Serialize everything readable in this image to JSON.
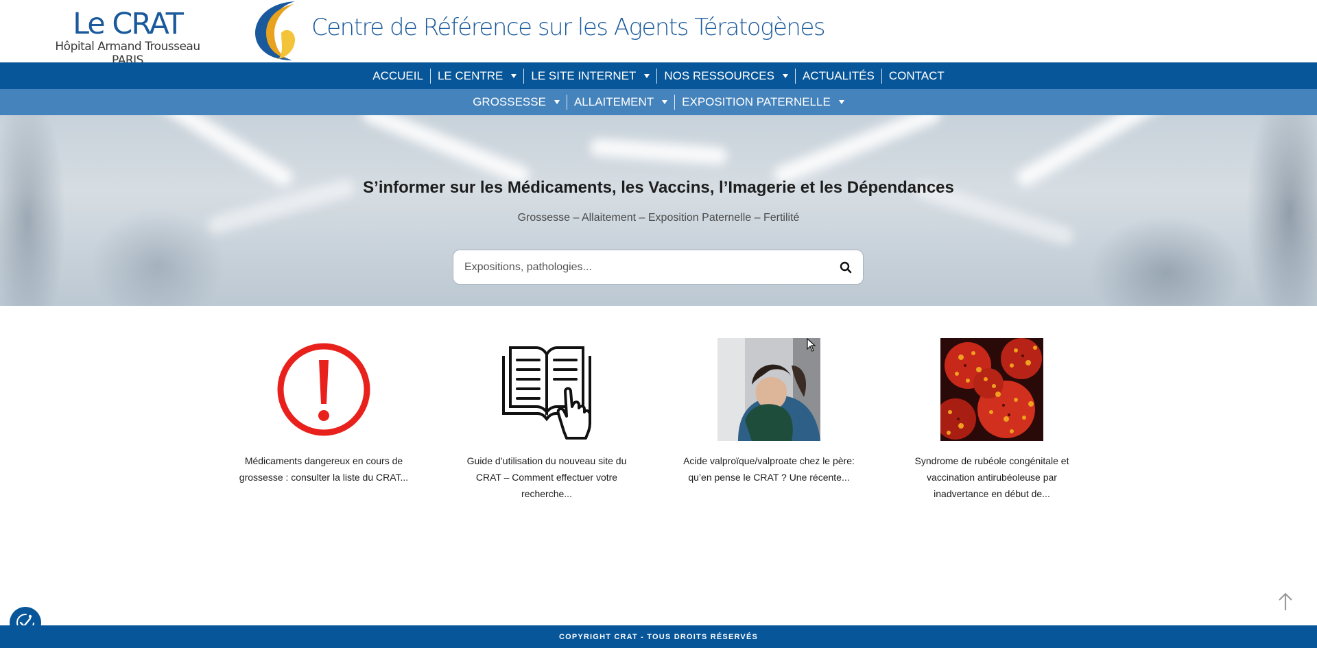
{
  "header": {
    "brand_name": "Le CRAT",
    "brand_sub": "Hôpital Armand Trousseau PARIS",
    "title": "Centre de Référence sur les Agents Tératogènes"
  },
  "nav_primary": [
    {
      "label": "ACCUEIL",
      "dropdown": false
    },
    {
      "label": "LE CENTRE",
      "dropdown": true
    },
    {
      "label": "LE SITE INTERNET",
      "dropdown": true
    },
    {
      "label": "NOS RESSOURCES",
      "dropdown": true
    },
    {
      "label": "ACTUALITÉS",
      "dropdown": false
    },
    {
      "label": "CONTACT",
      "dropdown": false
    }
  ],
  "nav_secondary": [
    {
      "label": "GROSSESSE",
      "dropdown": true
    },
    {
      "label": "ALLAITEMENT",
      "dropdown": true
    },
    {
      "label": "EXPOSITION PATERNELLE",
      "dropdown": true
    }
  ],
  "hero": {
    "title": "S’informer sur les Médicaments, les Vaccins, l’Imagerie et les Dépendances",
    "subtitle": "Grossesse – Allaitement – Exposition Paternelle – Fertilité",
    "search_placeholder": "Expositions, pathologies..."
  },
  "cards": [
    {
      "icon": "warning-exclamation-icon",
      "text": "Médicaments dangereux en cours de grossesse : consulter la liste du CRAT..."
    },
    {
      "icon": "open-book-hand-icon",
      "text": "Guide d’utilisation du nouveau site du CRAT – Comment effectuer votre recherche..."
    },
    {
      "icon": "father-child-photo",
      "text": "Acide valproïque/valproate chez le père: qu’en pense le CRAT ? Une récente..."
    },
    {
      "icon": "virus-photo",
      "text": "Syndrome de rubéole congénitale et vaccination antirubéoleuse par inadvertance en début de..."
    }
  ],
  "footer": {
    "copyright": "COPYRIGHT CRAT - TOUS DROITS RÉSERVÉS"
  },
  "colors": {
    "primary_nav": "#075699",
    "secondary_nav": "#4583bd",
    "brand_blue": "#1a5a9c",
    "logo_orange": "#e8a21e",
    "warning_red": "#e8211c"
  }
}
